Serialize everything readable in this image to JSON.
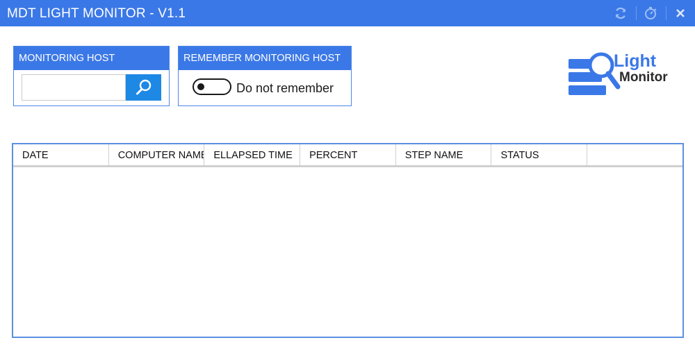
{
  "window": {
    "title": "MDT LIGHT MONITOR - V1.1",
    "accent_color": "#3b78e7",
    "icons": [
      "refresh-icon",
      "timer-icon",
      "close-icon"
    ]
  },
  "host_panel": {
    "header": "MONITORING HOST",
    "input_value": "",
    "input_placeholder": "",
    "search_icon": "search-icon"
  },
  "remember_panel": {
    "header": "REMEMBER MONITORING HOST",
    "toggle_state": "off",
    "toggle_label": "Do not remember"
  },
  "logo": {
    "line1": "Light",
    "line2": "Monitor"
  },
  "table": {
    "columns": [
      "DATE",
      "COMPUTER NAME",
      "ELLAPSED TIME",
      "PERCENT",
      "STEP NAME",
      "STATUS"
    ],
    "rows": []
  }
}
